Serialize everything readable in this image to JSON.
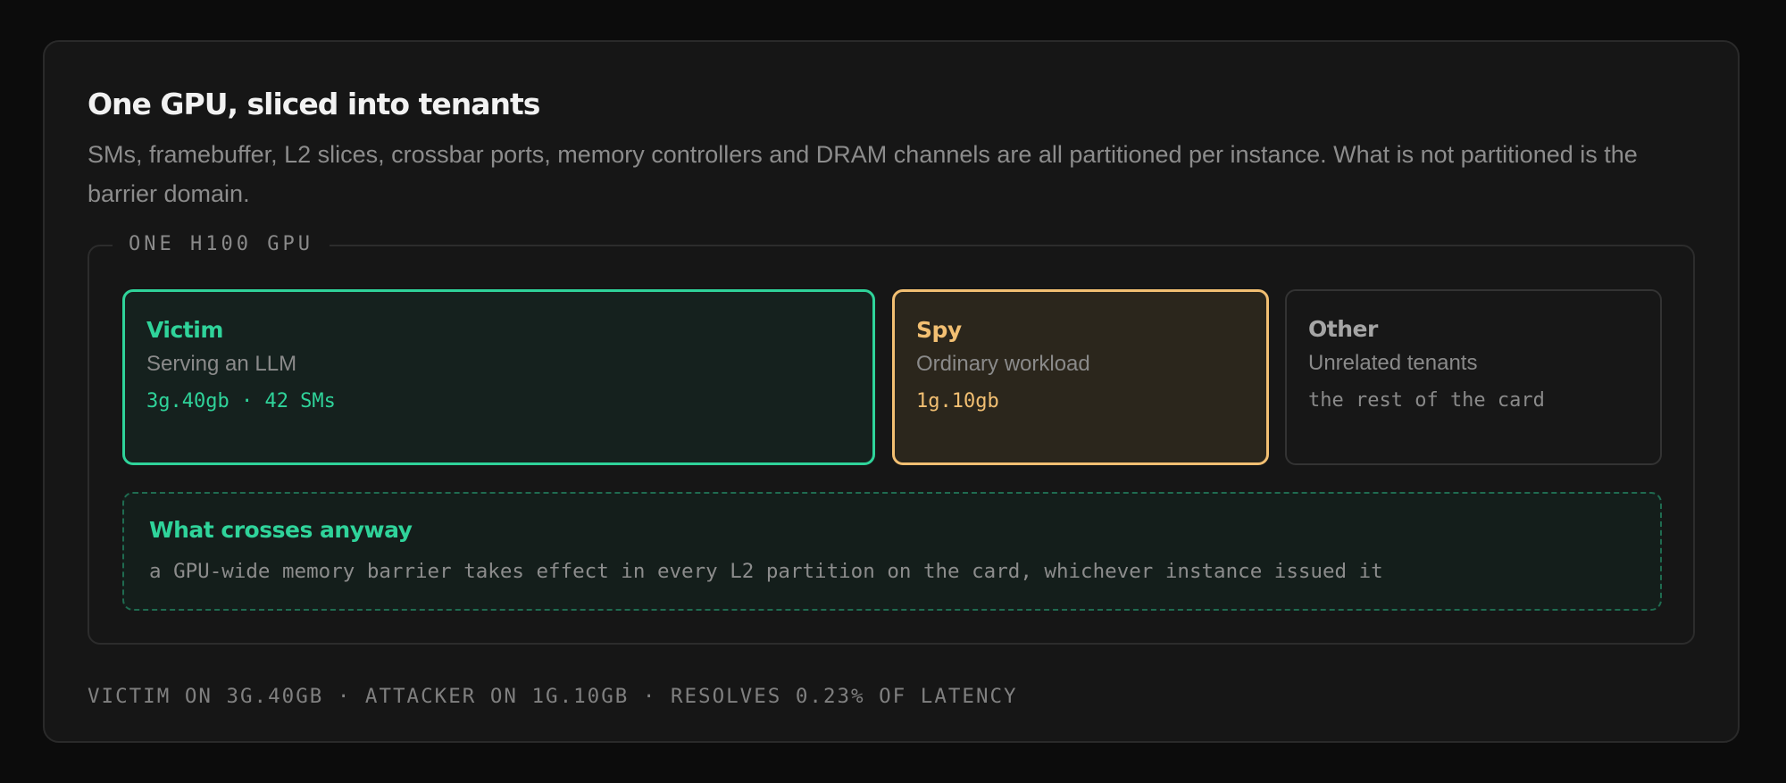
{
  "header": {
    "title": "One GPU, sliced into tenants",
    "subtitle": "SMs, framebuffer, L2 slices, crossbar ports, memory controllers and DRAM channels are all partitioned per instance. What is not partitioned is the barrier domain."
  },
  "gpu": {
    "label": "ONE H100 GPU",
    "tenants": [
      {
        "name": "Victim",
        "description": "Serving an LLM",
        "spec": "3g.40gb · 42 SMs",
        "color": "#2fd39a"
      },
      {
        "name": "Spy",
        "description": "Ordinary workload",
        "spec": "1g.10gb",
        "color": "#f2bf72"
      },
      {
        "name": "Other",
        "description": "Unrelated tenants",
        "spec": "the rest of the card",
        "color": "#a5a5a5"
      }
    ],
    "crosses": {
      "title": "What crosses anyway",
      "body": "a GPU-wide memory barrier takes effect in every L2 partition on the card, whichever instance issued it"
    }
  },
  "footer": {
    "text": "VICTIM ON 3G.40GB · ATTACKER ON 1G.10GB · RESOLVES 0.23% OF LATENCY"
  }
}
